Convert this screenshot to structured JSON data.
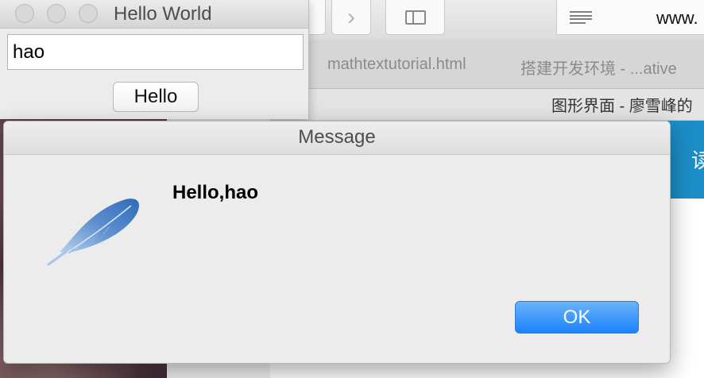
{
  "browser": {
    "address_text": "www.",
    "tabs": [
      {
        "label": "mathtextutorial.html"
      },
      {
        "label": "搭建开发环境 - ...ative"
      }
    ],
    "page_title": "图形界面 - 廖雪峰的",
    "banner_text": "读"
  },
  "hello_window": {
    "title": "Hello World",
    "input_value": "hao",
    "button_label": "Hello"
  },
  "dialog": {
    "title": "Message",
    "message": "Hello,hao",
    "icon": "feather-icon",
    "ok_label": "OK",
    "ok_color": "#1a82fb"
  }
}
